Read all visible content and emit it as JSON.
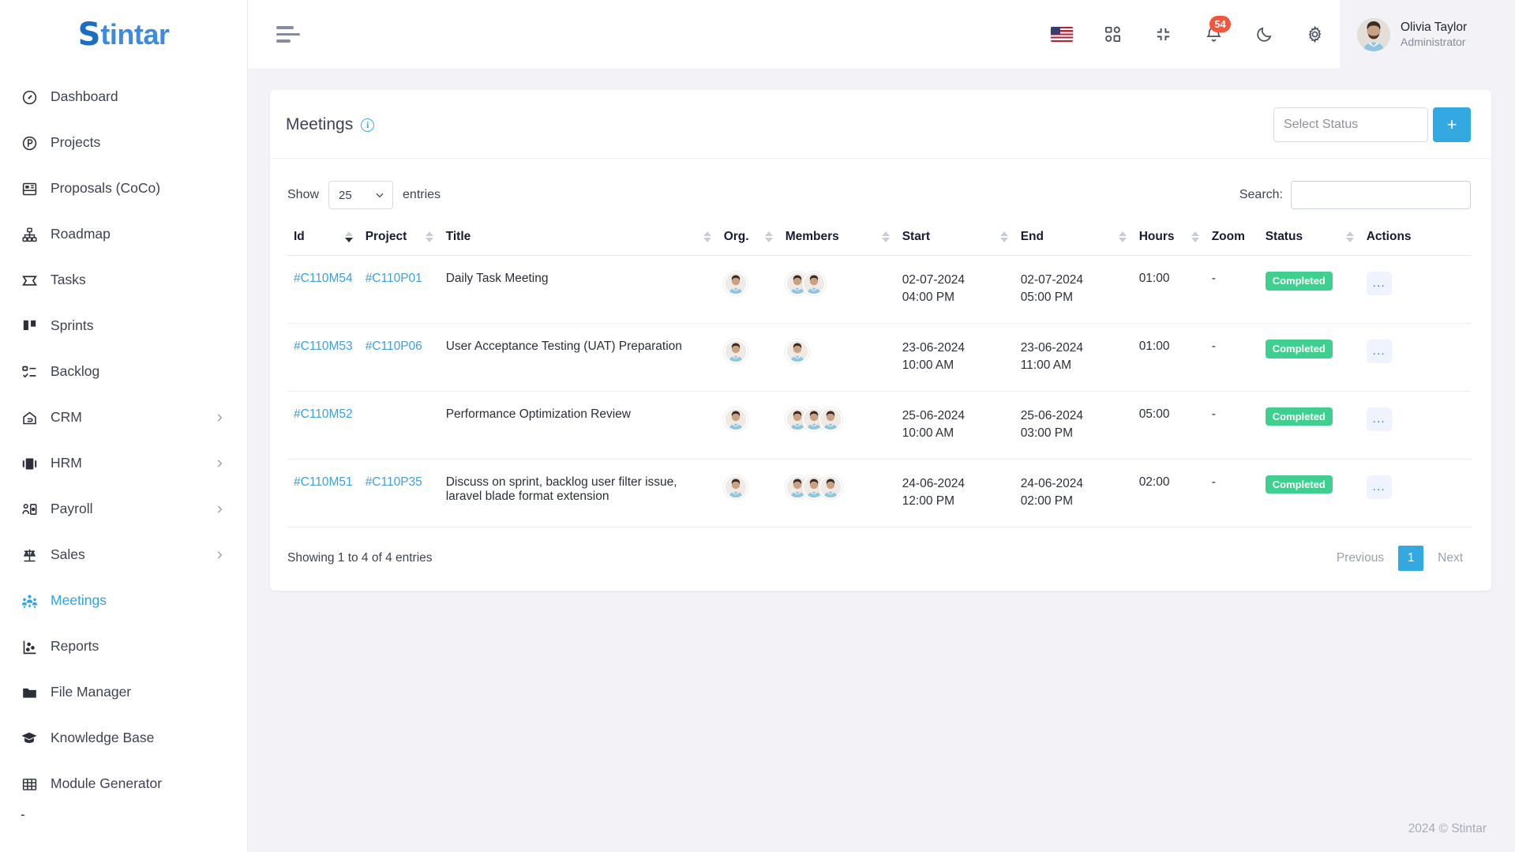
{
  "brand": {
    "first_letter": "S",
    "rest": "tintar"
  },
  "sidebar": {
    "items": [
      {
        "label": "Dashboard",
        "icon": "gauge-icon",
        "active": false,
        "expandable": false
      },
      {
        "label": "Projects",
        "icon": "project-circle-icon",
        "active": false,
        "expandable": false
      },
      {
        "label": "Proposals (CoCo)",
        "icon": "proposal-icon",
        "active": false,
        "expandable": false
      },
      {
        "label": "Roadmap",
        "icon": "roadmap-icon",
        "active": false,
        "expandable": false
      },
      {
        "label": "Tasks",
        "icon": "tasks-icon",
        "active": false,
        "expandable": false
      },
      {
        "label": "Sprints",
        "icon": "sprints-icon",
        "active": false,
        "expandable": false
      },
      {
        "label": "Backlog",
        "icon": "backlog-icon",
        "active": false,
        "expandable": false
      },
      {
        "label": "CRM",
        "icon": "crm-icon",
        "active": false,
        "expandable": true
      },
      {
        "label": "HRM",
        "icon": "hrm-icon",
        "active": false,
        "expandable": true
      },
      {
        "label": "Payroll",
        "icon": "payroll-icon",
        "active": false,
        "expandable": true
      },
      {
        "label": "Sales",
        "icon": "sales-scale-icon",
        "active": false,
        "expandable": true
      },
      {
        "label": "Meetings",
        "icon": "meetings-people-icon",
        "active": true,
        "expandable": false
      },
      {
        "label": "Reports",
        "icon": "reports-icon",
        "active": false,
        "expandable": false
      },
      {
        "label": "File Manager",
        "icon": "folder-icon",
        "active": false,
        "expandable": false
      },
      {
        "label": "Knowledge Base",
        "icon": "graduation-cap-icon",
        "active": false,
        "expandable": false
      },
      {
        "label": "Module Generator",
        "icon": "grid-table-icon",
        "active": false,
        "expandable": false
      }
    ],
    "partial_item": "-"
  },
  "topbar": {
    "menu_toggle": "hamburger-icon",
    "icons": [
      "flag-us-icon",
      "apps-grid-icon",
      "compress-icon",
      "bell-icon",
      "moon-icon",
      "gear-icon"
    ],
    "notification_count": "54",
    "user": {
      "name": "Olivia Taylor",
      "role": "Administrator"
    }
  },
  "card": {
    "title": "Meetings",
    "info_glyph": "i",
    "status_filter_placeholder": "Select Status",
    "add_label": "+"
  },
  "table_controls": {
    "show_label": "Show",
    "entries_label": "entries",
    "page_size": "25",
    "search_label": "Search:",
    "search_value": "",
    "search_placeholder": ""
  },
  "table": {
    "columns": [
      {
        "label": "Id",
        "sortable": true,
        "sorted": "desc"
      },
      {
        "label": "Project",
        "sortable": true,
        "sorted": "none"
      },
      {
        "label": "Title",
        "sortable": true,
        "sorted": "none"
      },
      {
        "label": "Org.",
        "sortable": true,
        "sorted": "none"
      },
      {
        "label": "Members",
        "sortable": true,
        "sorted": "none"
      },
      {
        "label": "Start",
        "sortable": true,
        "sorted": "none"
      },
      {
        "label": "End",
        "sortable": true,
        "sorted": "none"
      },
      {
        "label": "Hours",
        "sortable": true,
        "sorted": "none"
      },
      {
        "label": "Zoom",
        "sortable": false,
        "sorted": "none"
      },
      {
        "label": "Status",
        "sortable": true,
        "sorted": "none"
      },
      {
        "label": "Actions",
        "sortable": false,
        "sorted": "none"
      }
    ],
    "rows": [
      {
        "id": "#C110M54",
        "project": "#C110P01",
        "title": "Daily Task Meeting",
        "org_count": 1,
        "member_count": 2,
        "start_date": "02-07-2024",
        "start_time": "04:00 PM",
        "end_date": "02-07-2024",
        "end_time": "05:00 PM",
        "hours": "01:00",
        "zoom": "-",
        "status": "Completed",
        "actions": "..."
      },
      {
        "id": "#C110M53",
        "project": "#C110P06",
        "title": "User Acceptance Testing (UAT) Preparation",
        "org_count": 1,
        "member_count": 1,
        "start_date": "23-06-2024",
        "start_time": "10:00 AM",
        "end_date": "23-06-2024",
        "end_time": "11:00 AM",
        "hours": "01:00",
        "zoom": "-",
        "status": "Completed",
        "actions": "..."
      },
      {
        "id": "#C110M52",
        "project": "",
        "title": "Performance Optimization Review",
        "org_count": 1,
        "member_count": 3,
        "start_date": "25-06-2024",
        "start_time": "10:00 AM",
        "end_date": "25-06-2024",
        "end_time": "03:00 PM",
        "hours": "05:00",
        "zoom": "-",
        "status": "Completed",
        "actions": "..."
      },
      {
        "id": "#C110M51",
        "project": "#C110P35",
        "title": "Discuss on sprint, backlog user filter issue, laravel blade format extension",
        "org_count": 1,
        "member_count": 3,
        "start_date": "24-06-2024",
        "start_time": "12:00 PM",
        "end_date": "24-06-2024",
        "end_time": "02:00 PM",
        "hours": "02:00",
        "zoom": "-",
        "status": "Completed",
        "actions": "..."
      }
    ]
  },
  "table_footer": {
    "info": "Showing 1 to 4 of 4 entries",
    "previous": "Previous",
    "current_page": "1",
    "next": "Next"
  },
  "page_footer": {
    "copyright": "2024 © Stintar"
  },
  "colors": {
    "accent": "#34a8e0",
    "brand": "#3d8be0",
    "status_completed": "#3fcf8e",
    "badge": "#f4553d",
    "link": "#3fa0e0"
  }
}
